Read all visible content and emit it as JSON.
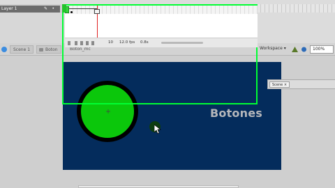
{
  "timeline": {
    "layer_name": "Layer 1"
  },
  "status_bar": {
    "frame": "10",
    "fps": "12.0 fps",
    "time": "0.8s"
  },
  "edit_bar": {
    "scene": "Scene 1",
    "symbol_parent": "Boton",
    "symbol": "Boton_mc",
    "workspace": "Workspace ▾",
    "zoom": "100%"
  },
  "stage": {
    "title": "Botones"
  },
  "scene_panel": {
    "tab": "Scene ×"
  },
  "colors": {
    "stage_bg": "#042c5c",
    "circle_fill": "#0bc70b",
    "outline_highlight": "#00ff33"
  }
}
